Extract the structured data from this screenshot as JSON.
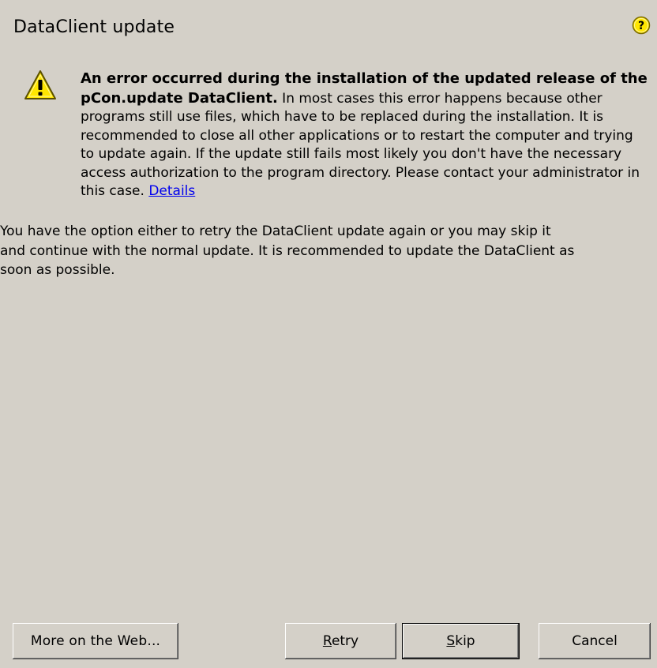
{
  "dialog": {
    "title": "DataClient update",
    "help_icon": "help-question-icon",
    "warning_icon": "warning-triangle-icon",
    "error_bold": "An error occurred during the installation of the updated release of the pCon.update DataClient.",
    "error_body": " In most cases this error happens because other programs still use files, which have to be replaced during the installation. It is recommended to close all other applications or to restart the computer and trying to update again. If the update still fails most likely you don't have the necessary access authorization to the program directory. Please contact your administrator in this case. ",
    "details_link": "Details",
    "option_text": "You have the option either to retry the DataClient update again or you may skip it\nand continue with the normal update. It is recommended to update the DataClient as\nsoon as possible."
  },
  "buttons": {
    "web_label": "More on the Web...",
    "retry_mnemonic": "R",
    "retry_rest": "etry",
    "skip_mnemonic": "S",
    "skip_rest": "kip",
    "cancel_label": "Cancel"
  },
  "colors": {
    "background": "#d4d0c8",
    "link": "#0000ee",
    "warning_fill": "#ffe600",
    "help_fill": "#ffe600"
  }
}
